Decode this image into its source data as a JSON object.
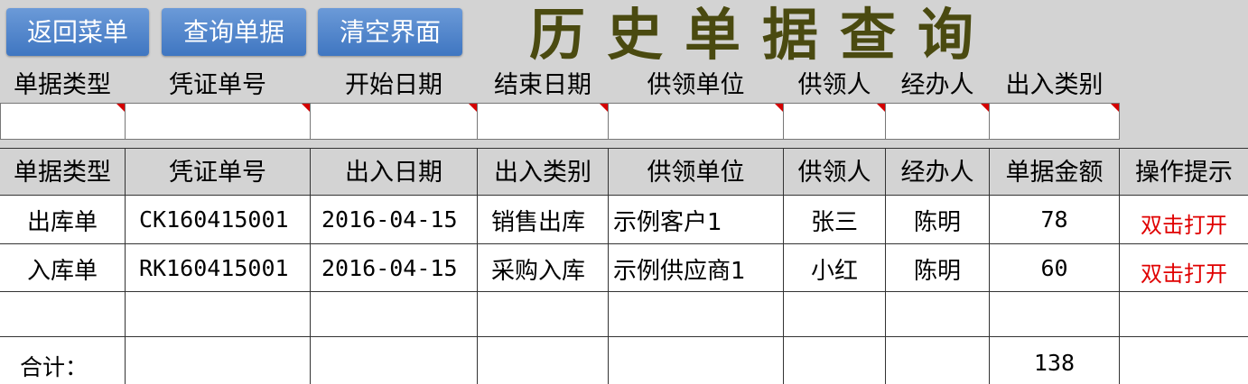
{
  "toolbar": {
    "back_label": "返回菜单",
    "query_label": "查询单据",
    "clear_label": "清空界面"
  },
  "title": "历史单据查询",
  "query": {
    "labels": [
      "单据类型",
      "凭证单号",
      "开始日期",
      "结束日期",
      "供领单位",
      "供领人",
      "经办人",
      "出入类别"
    ],
    "values": [
      "",
      "",
      "",
      "",
      "",
      "",
      "",
      ""
    ]
  },
  "table": {
    "headers": [
      "单据类型",
      "凭证单号",
      "出入日期",
      "出入类别",
      "供领单位",
      "供领人",
      "经办人",
      "单据金额",
      "操作提示"
    ],
    "rows": [
      {
        "type": "出库单",
        "voucher": "CK160415001",
        "date": "2016-04-15",
        "category": "销售出库",
        "unit": "示例客户1",
        "person": "张三",
        "handler": "陈明",
        "amount": "78",
        "action": "双击打开"
      },
      {
        "type": "入库单",
        "voucher": "RK160415001",
        "date": "2016-04-15",
        "category": "采购入库",
        "unit": "示例供应商1",
        "person": "小红",
        "handler": "陈明",
        "amount": "60",
        "action": "双击打开"
      }
    ],
    "total_label": "合计：",
    "total_amount": "138"
  },
  "colors": {
    "button": "#4a7fc9",
    "title": "#4a4a10",
    "action_link": "#e00000",
    "header_bg": "#d3d3d3"
  }
}
